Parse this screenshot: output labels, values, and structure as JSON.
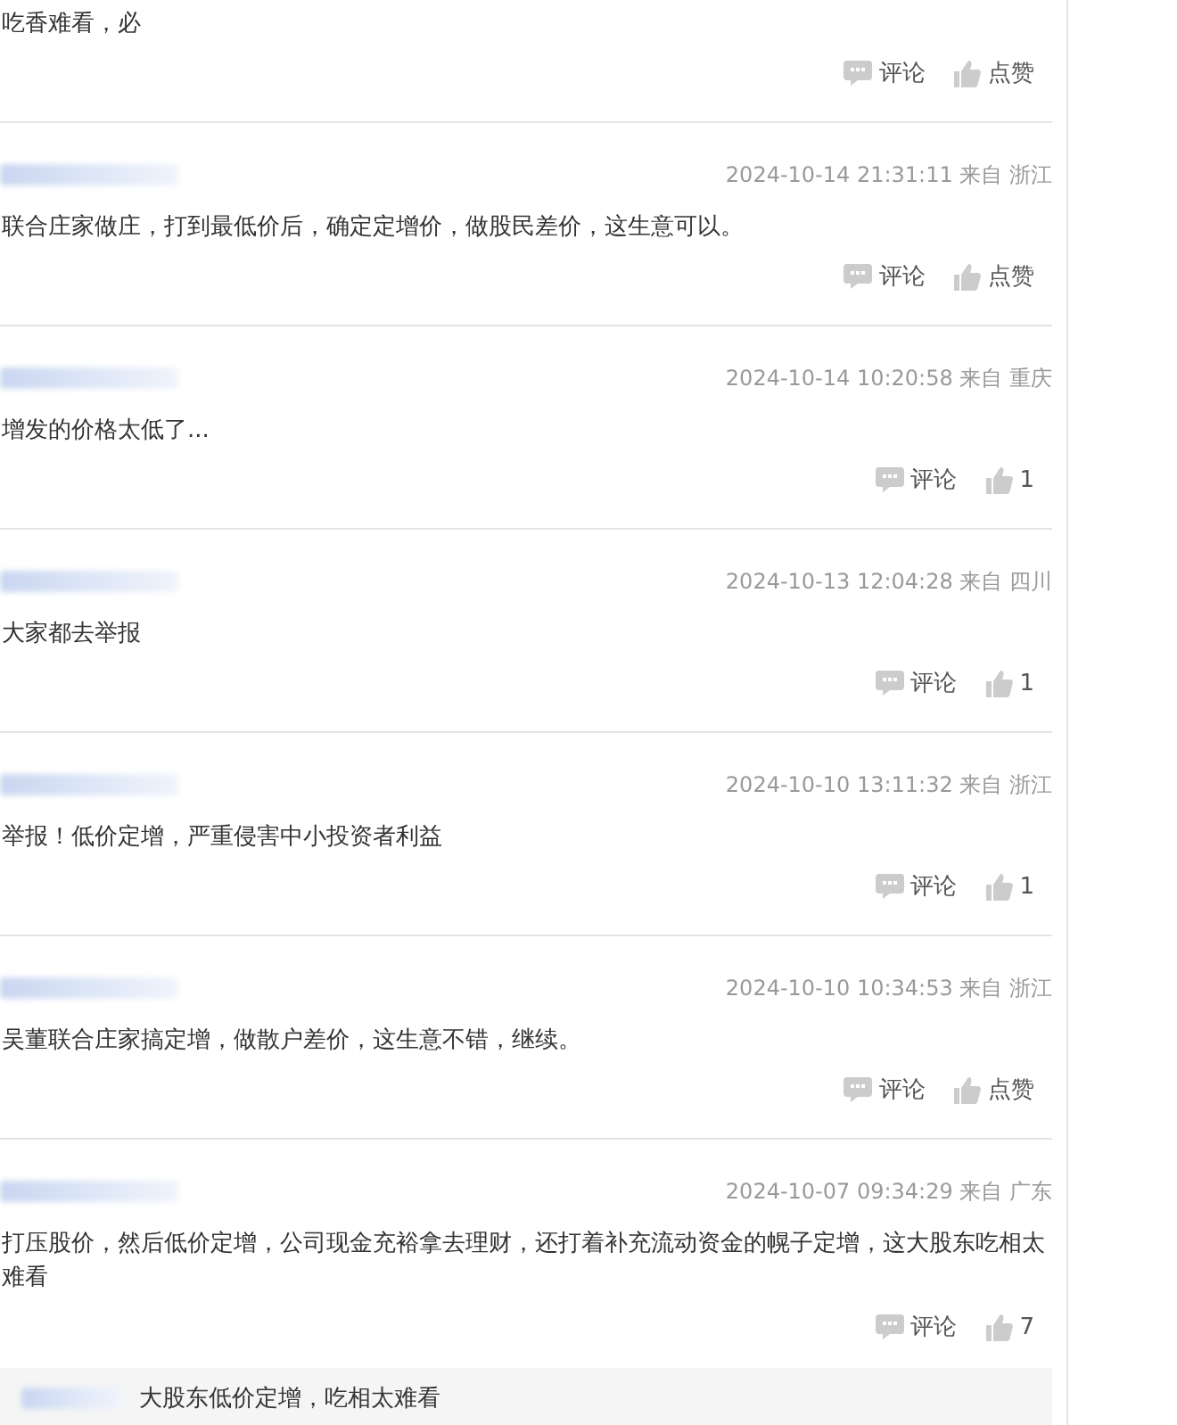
{
  "comments": [
    {
      "text": "吃香难看，必",
      "comment_label": "评论",
      "like_label": "点赞"
    },
    {
      "time": "2024-10-14 21:31:11 来自 浙江",
      "text": "联合庄家做庄，打到最低价后，确定定增价，做股民差价，这生意可以。",
      "comment_label": "评论",
      "like_label": "点赞"
    },
    {
      "time": "2024-10-14 10:20:58 来自 重庆",
      "text": "增发的价格太低了...",
      "comment_label": "评论",
      "like_label": "1"
    },
    {
      "time": "2024-10-13 12:04:28 来自 四川",
      "text": "大家都去举报",
      "comment_label": "评论",
      "like_label": "1"
    },
    {
      "time": "2024-10-10 13:11:32 来自 浙江",
      "text": "举报！低价定增，严重侵害中小投资者利益",
      "comment_label": "评论",
      "like_label": "1"
    },
    {
      "time": "2024-10-10 10:34:53 来自 浙江",
      "text": "吴董联合庄家搞定增，做散户差价，这生意不错，继续。",
      "comment_label": "评论",
      "like_label": "点赞"
    },
    {
      "time": "2024-10-07 09:34:29 来自 广东",
      "text": "打压股价，然后低价定增，公司现金充裕拿去理财，还打着补充流动资金的幌子定增，这大股东吃相太难看",
      "comment_label": "评论",
      "like_label": "7",
      "replies": [
        {
          "text": "大股东低价定增，吃相太难看"
        }
      ]
    }
  ]
}
